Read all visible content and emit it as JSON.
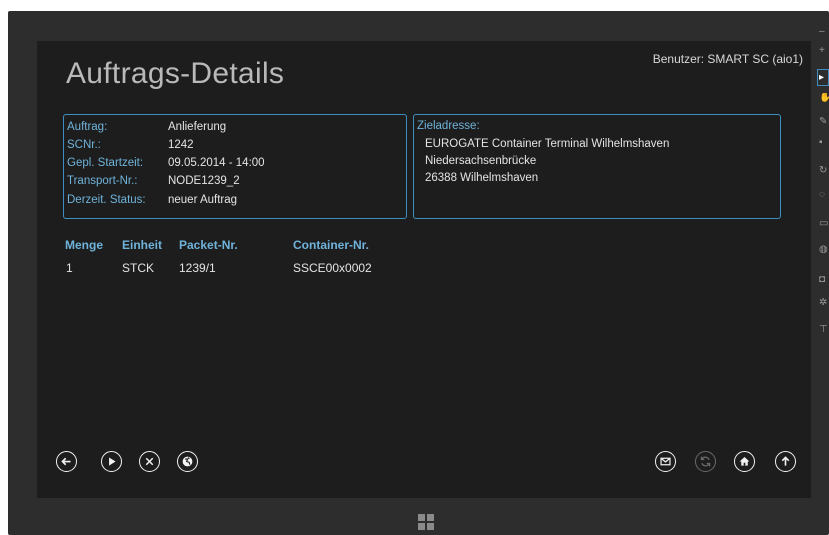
{
  "header": {
    "user_label": "Benutzer: SMART SC (aio1)",
    "title": "Auftrags-Details"
  },
  "order": {
    "fields": [
      {
        "label": "Auftrag:",
        "value": "Anlieferung"
      },
      {
        "label": "SCNr.:",
        "value": "1242"
      },
      {
        "label": "Gepl. Startzeit:",
        "value": "09.05.2014 - 14:00"
      },
      {
        "label": "Transport-Nr.:",
        "value": "NODE1239_2"
      },
      {
        "label": "Derzeit. Status:",
        "value": "neuer Auftrag"
      }
    ]
  },
  "address": {
    "label": "Zieladresse:",
    "lines": [
      "EUROGATE Container Terminal Wilhelmshaven",
      "Niedersachsenbrücke",
      "26388 Wilhelmshaven"
    ]
  },
  "table": {
    "headers": [
      "Menge",
      "Einheit",
      "Packet-Nr.",
      "Container-Nr."
    ],
    "rows": [
      [
        "1",
        "STCK",
        "1239/1",
        "SSCE00x0002"
      ]
    ]
  },
  "buttons": {
    "left": [
      "back-arrow-icon",
      "play-icon",
      "cancel-icon",
      "globe-icon"
    ],
    "right": [
      "mail-icon",
      "refresh-icon",
      "home-icon",
      "up-arrow-icon"
    ],
    "disabled": [
      "refresh-icon"
    ]
  },
  "colors": {
    "accent": "#3e8fbf",
    "label_text": "#6fb3da",
    "value_text": "#e4e4e4",
    "background": "#1d1d1d"
  }
}
